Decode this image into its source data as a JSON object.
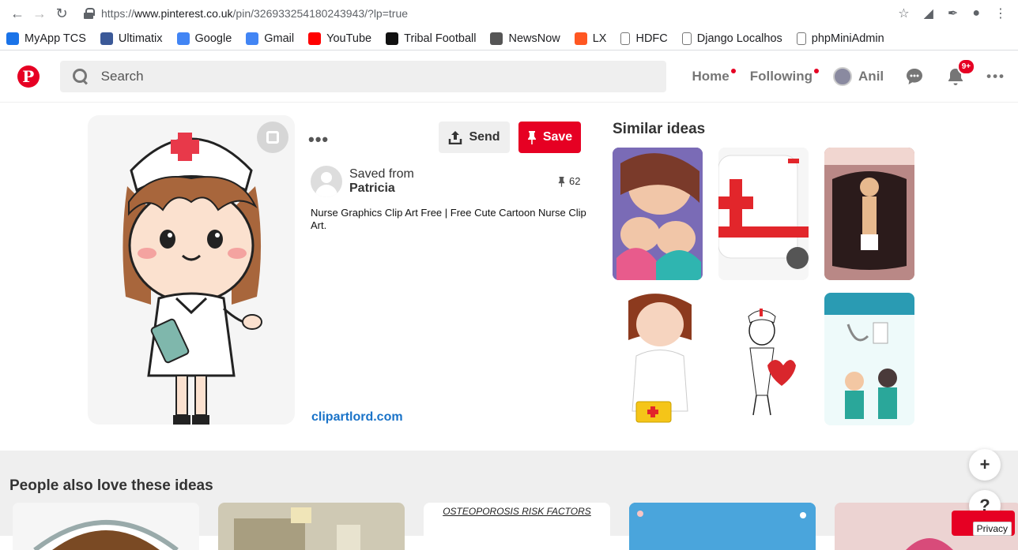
{
  "browser": {
    "url_prefix": "https://",
    "url_host": "www.pinterest.co.uk",
    "url_path": "/pin/326933254180243943/?lp=true",
    "bookmarks": [
      {
        "label": "MyApp TCS",
        "icon": "briefcase-icon",
        "color": "#1a73e8"
      },
      {
        "label": "Ultimatix",
        "icon": "tata-icon",
        "color": "#3b5998"
      },
      {
        "label": "Google",
        "icon": "google-icon",
        "color": "#4285f4"
      },
      {
        "label": "Gmail",
        "icon": "google-icon",
        "color": "#4285f4"
      },
      {
        "label": "YouTube",
        "icon": "youtube-icon",
        "color": "#ff0000"
      },
      {
        "label": "Tribal Football",
        "icon": "tf-icon",
        "color": "#111111"
      },
      {
        "label": "NewsNow",
        "icon": "newsnow-icon",
        "color": "#555555"
      },
      {
        "label": "LX",
        "icon": "power-icon",
        "color": "#ff5722"
      },
      {
        "label": "HDFC",
        "icon": "page-icon",
        "color": "#777777"
      },
      {
        "label": "Django Localhos",
        "icon": "page-icon",
        "color": "#777777"
      },
      {
        "label": "phpMiniAdmin",
        "icon": "page-icon",
        "color": "#777777"
      }
    ]
  },
  "header": {
    "logo_letter": "P",
    "search_placeholder": "Search",
    "home": "Home",
    "following": "Following",
    "user_name": "Anil",
    "notifications_badge": "9+",
    "more": "•••"
  },
  "pin": {
    "send_label": "Send",
    "save_label": "Save",
    "saved_from_label": "Saved from",
    "saved_from_user": "Patricia",
    "repin_count": "62",
    "description": "Nurse Graphics Clip Art Free | Free Cute Cartoon Nurse Clip Art.",
    "source": "clipartlord.com",
    "more_dots": "•••"
  },
  "similar": {
    "title": "Similar ideas"
  },
  "lower": {
    "title": "People also love these ideas",
    "card3_text": "OSTEOPOROSIS RISK FACTORS",
    "privacy": "Privacy",
    "plus": "+",
    "help": "?"
  },
  "colors": {
    "pinterest_red": "#e60023",
    "link_blue": "#1a73c8"
  }
}
